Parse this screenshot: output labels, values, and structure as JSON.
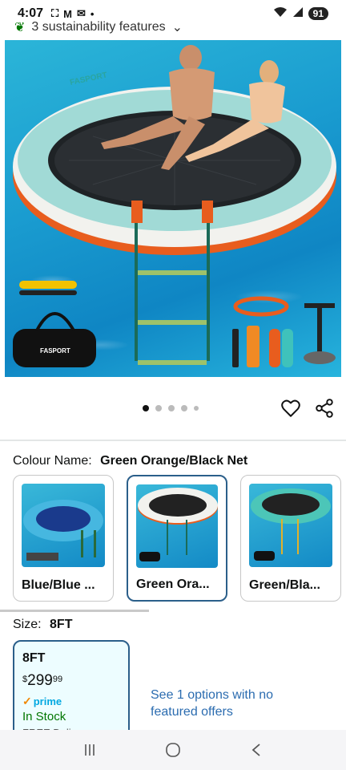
{
  "status_bar": {
    "time": "4:07",
    "battery": "91"
  },
  "sustainability": {
    "label": "3 sustainability features"
  },
  "product_image": {
    "brand_logo": "FASPORT",
    "pager": {
      "total": 5,
      "active_index": 0
    }
  },
  "colour": {
    "label": "Colour Name:",
    "value": "Green Orange/Black Net",
    "options": [
      {
        "name": "Blue/Blue ...",
        "selected": false
      },
      {
        "name": "Green Ora...",
        "selected": true
      },
      {
        "name": "Green/Bla...",
        "selected": false
      }
    ]
  },
  "size": {
    "label": "Size:",
    "value": "8FT",
    "card": {
      "name": "8FT",
      "currency": "$",
      "price_whole": "299",
      "price_fraction": "99",
      "prime_label": "prime",
      "stock": "In Stock",
      "delivery": "FREE Deli..."
    },
    "see_options": "See 1 options with no featured offers"
  },
  "colors": {
    "accent_border": "#2b5f8a",
    "stock_green": "#007600",
    "link_blue": "#2b6cb0",
    "prime_blue": "#00a8e1"
  }
}
